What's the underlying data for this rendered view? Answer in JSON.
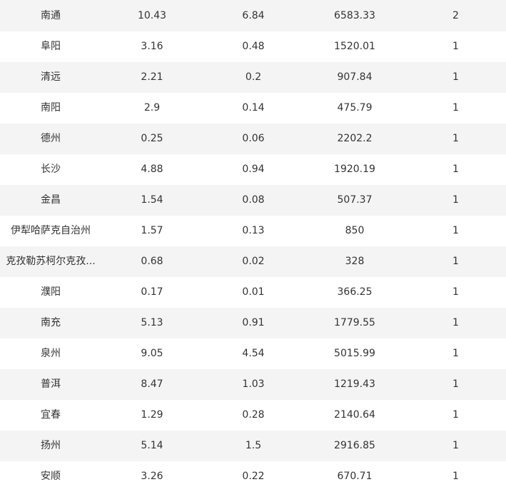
{
  "table": {
    "rows": [
      [
        "南通",
        "10.43",
        "6.84",
        "6583.33",
        "2"
      ],
      [
        "阜阳",
        "3.16",
        "0.48",
        "1520.01",
        "1"
      ],
      [
        "清远",
        "2.21",
        "0.2",
        "907.84",
        "1"
      ],
      [
        "南阳",
        "2.9",
        "0.14",
        "475.79",
        "1"
      ],
      [
        "德州",
        "0.25",
        "0.06",
        "2202.2",
        "1"
      ],
      [
        "长沙",
        "4.88",
        "0.94",
        "1920.19",
        "1"
      ],
      [
        "金昌",
        "1.54",
        "0.08",
        "507.37",
        "1"
      ],
      [
        "伊犁哈萨克自治州",
        "1.57",
        "0.13",
        "850",
        "1"
      ],
      [
        "克孜勒苏柯尔克孜...",
        "0.68",
        "0.02",
        "328",
        "1"
      ],
      [
        "濮阳",
        "0.17",
        "0.01",
        "366.25",
        "1"
      ],
      [
        "南充",
        "5.13",
        "0.91",
        "1779.55",
        "1"
      ],
      [
        "泉州",
        "9.05",
        "4.54",
        "5015.99",
        "1"
      ],
      [
        "普洱",
        "8.47",
        "1.03",
        "1219.43",
        "1"
      ],
      [
        "宜春",
        "1.29",
        "0.28",
        "2140.64",
        "1"
      ],
      [
        "扬州",
        "5.14",
        "1.5",
        "2916.85",
        "1"
      ],
      [
        "安顺",
        "3.26",
        "0.22",
        "670.71",
        "1"
      ]
    ]
  },
  "colors": {
    "stripe": "#f4f4f4",
    "text": "#333333"
  }
}
